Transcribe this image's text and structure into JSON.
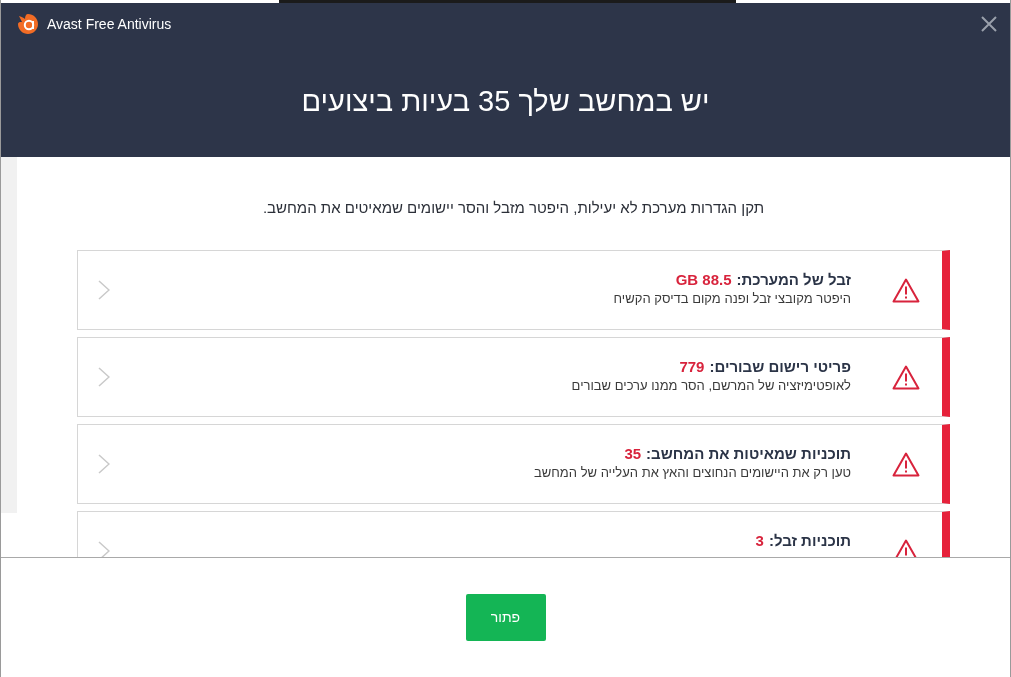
{
  "window": {
    "app_name": "Avast Free Antivirus"
  },
  "headline": "יש במחשב שלך 35 בעיות ביצועים",
  "subtitle": "תקן הגדרות מערכת לא יעילות, היפטר מזבל והסר יישומים שמאיטים את המחשב.",
  "issues": [
    {
      "title": "זבל של המערכת:",
      "value": "88.5 GB",
      "description": "היפטר מקובצי זבל ופנה מקום בדיסק הקשיח"
    },
    {
      "title": "פריטי רישום שבורים:",
      "value": "779",
      "description": "לאופטימיזציה של המרשם, הסר ממנו ערכים שבורים"
    },
    {
      "title": "תוכניות שמאיטות את המחשב:",
      "value": "35",
      "description": "טען רק את היישומים הנחוצים והאץ את העלייה של המחשב"
    },
    {
      "title": "תוכניות זבל:",
      "value": "3"
    }
  ],
  "fix_button": "פתור"
}
